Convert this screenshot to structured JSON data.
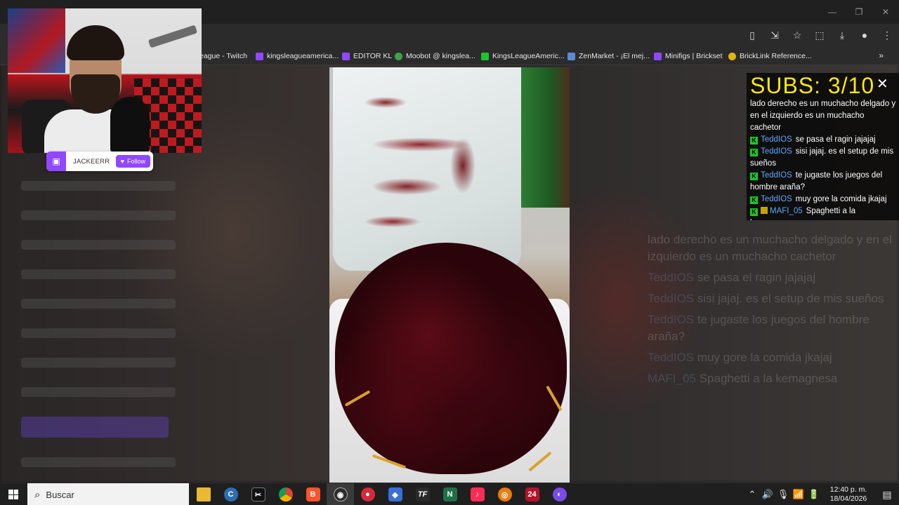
{
  "browser": {
    "window_controls": [
      "—",
      "❐",
      "✕"
    ],
    "bookmarks": [
      {
        "label": "eague - Twitch",
        "color": "#9146ff"
      },
      {
        "label": "kingsleagueamerica...",
        "color": "#9146ff"
      },
      {
        "label": "EDITOR KL",
        "color": "#9146ff"
      },
      {
        "label": "Moobot @ kingslea...",
        "color": "#3da34a"
      },
      {
        "label": "KingsLeagueAmeric...",
        "color": "#18c928"
      },
      {
        "label": "ZenMarket - ¡El mej...",
        "color": "#5b8bd6"
      },
      {
        "label": "Minifigs | Brickset",
        "color": "#9146ff"
      },
      {
        "label": "BrickLink Reference...",
        "color": "#e3b514"
      }
    ],
    "bookmarks_more": "»"
  },
  "webcam": {
    "channel_name": "JACKEERR",
    "follow_label": "Follow"
  },
  "chat": {
    "subs_text": "SUBS:  3/10",
    "close_icon": "✕",
    "messages": [
      {
        "badges": [],
        "user": "",
        "text": "lado derecho es un muchacho delgado y en el izquierdo es un muchacho cachetor"
      },
      {
        "badges": [
          "K"
        ],
        "user": "TeddIOS",
        "text": "se pasa el ragin jajajaj"
      },
      {
        "badges": [
          "K"
        ],
        "user": "TeddIOS",
        "text": "sisi jajaj. es el setup de mis sueños"
      },
      {
        "badges": [
          "K"
        ],
        "user": "TeddIOS",
        "text": "te jugaste los juegos del hombre araña?"
      },
      {
        "badges": [
          "K"
        ],
        "user": "TeddIOS",
        "text": "muy gore la comida jkajaj"
      },
      {
        "badges": [
          "K",
          "mod"
        ],
        "user": "MAFI_05",
        "text": "Spaghetti a la kemagnesa"
      }
    ]
  },
  "taskbar": {
    "search_placeholder": "Buscar",
    "apps": [
      {
        "name": "file-explorer",
        "glyph": "",
        "color": "#e8b931"
      },
      {
        "name": "ccleaner",
        "glyph": "C",
        "color": "#2b6fb3"
      },
      {
        "name": "capcut",
        "glyph": "✂",
        "color": "#111111"
      },
      {
        "name": "chrome",
        "glyph": "",
        "color": "#4caf50"
      },
      {
        "name": "brave",
        "glyph": "B",
        "color": "#fb542b"
      },
      {
        "name": "obs",
        "glyph": "◉",
        "color": "#2d2d2d"
      },
      {
        "name": "app-red",
        "glyph": "●",
        "color": "#d62a3a"
      },
      {
        "name": "app-blue",
        "glyph": "◆",
        "color": "#3a6fd8"
      },
      {
        "name": "tf",
        "glyph": "TF",
        "color": "#2a2a2a"
      },
      {
        "name": "excel",
        "glyph": "N",
        "color": "#1e7145"
      },
      {
        "name": "tiktok",
        "glyph": "♪",
        "color": "#fe2c55"
      },
      {
        "name": "blender",
        "glyph": "◎",
        "color": "#e87d0d"
      },
      {
        "name": "game-2024",
        "glyph": "24",
        "color": "#b3122a"
      },
      {
        "name": "app-purple",
        "glyph": "◐",
        "color": "#7a4be6"
      }
    ],
    "tray_icons": [
      "⌃",
      "🔊",
      "🎙",
      "📶",
      "🔋"
    ],
    "time": "12:40 p. m.",
    "date": "18/04/2026",
    "notification_icon": "▤"
  }
}
